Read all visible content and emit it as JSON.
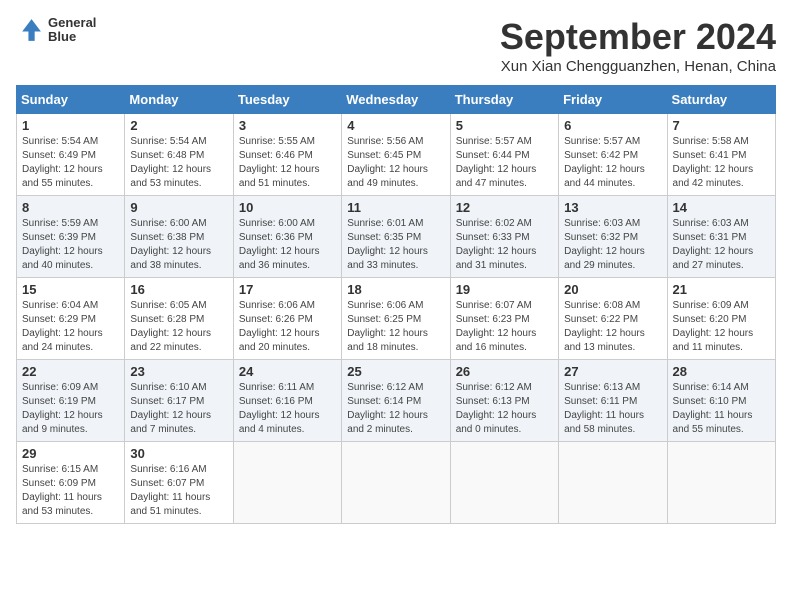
{
  "logo": {
    "line1": "General",
    "line2": "Blue"
  },
  "title": "September 2024",
  "location": "Xun Xian Chengguanzhen, Henan, China",
  "headers": [
    "Sunday",
    "Monday",
    "Tuesday",
    "Wednesday",
    "Thursday",
    "Friday",
    "Saturday"
  ],
  "weeks": [
    [
      {
        "day": "1",
        "sunrise": "5:54 AM",
        "sunset": "6:49 PM",
        "daylight": "12 hours and 55 minutes."
      },
      {
        "day": "2",
        "sunrise": "5:54 AM",
        "sunset": "6:48 PM",
        "daylight": "12 hours and 53 minutes."
      },
      {
        "day": "3",
        "sunrise": "5:55 AM",
        "sunset": "6:46 PM",
        "daylight": "12 hours and 51 minutes."
      },
      {
        "day": "4",
        "sunrise": "5:56 AM",
        "sunset": "6:45 PM",
        "daylight": "12 hours and 49 minutes."
      },
      {
        "day": "5",
        "sunrise": "5:57 AM",
        "sunset": "6:44 PM",
        "daylight": "12 hours and 47 minutes."
      },
      {
        "day": "6",
        "sunrise": "5:57 AM",
        "sunset": "6:42 PM",
        "daylight": "12 hours and 44 minutes."
      },
      {
        "day": "7",
        "sunrise": "5:58 AM",
        "sunset": "6:41 PM",
        "daylight": "12 hours and 42 minutes."
      }
    ],
    [
      {
        "day": "8",
        "sunrise": "5:59 AM",
        "sunset": "6:39 PM",
        "daylight": "12 hours and 40 minutes."
      },
      {
        "day": "9",
        "sunrise": "6:00 AM",
        "sunset": "6:38 PM",
        "daylight": "12 hours and 38 minutes."
      },
      {
        "day": "10",
        "sunrise": "6:00 AM",
        "sunset": "6:36 PM",
        "daylight": "12 hours and 36 minutes."
      },
      {
        "day": "11",
        "sunrise": "6:01 AM",
        "sunset": "6:35 PM",
        "daylight": "12 hours and 33 minutes."
      },
      {
        "day": "12",
        "sunrise": "6:02 AM",
        "sunset": "6:33 PM",
        "daylight": "12 hours and 31 minutes."
      },
      {
        "day": "13",
        "sunrise": "6:03 AM",
        "sunset": "6:32 PM",
        "daylight": "12 hours and 29 minutes."
      },
      {
        "day": "14",
        "sunrise": "6:03 AM",
        "sunset": "6:31 PM",
        "daylight": "12 hours and 27 minutes."
      }
    ],
    [
      {
        "day": "15",
        "sunrise": "6:04 AM",
        "sunset": "6:29 PM",
        "daylight": "12 hours and 24 minutes."
      },
      {
        "day": "16",
        "sunrise": "6:05 AM",
        "sunset": "6:28 PM",
        "daylight": "12 hours and 22 minutes."
      },
      {
        "day": "17",
        "sunrise": "6:06 AM",
        "sunset": "6:26 PM",
        "daylight": "12 hours and 20 minutes."
      },
      {
        "day": "18",
        "sunrise": "6:06 AM",
        "sunset": "6:25 PM",
        "daylight": "12 hours and 18 minutes."
      },
      {
        "day": "19",
        "sunrise": "6:07 AM",
        "sunset": "6:23 PM",
        "daylight": "12 hours and 16 minutes."
      },
      {
        "day": "20",
        "sunrise": "6:08 AM",
        "sunset": "6:22 PM",
        "daylight": "12 hours and 13 minutes."
      },
      {
        "day": "21",
        "sunrise": "6:09 AM",
        "sunset": "6:20 PM",
        "daylight": "12 hours and 11 minutes."
      }
    ],
    [
      {
        "day": "22",
        "sunrise": "6:09 AM",
        "sunset": "6:19 PM",
        "daylight": "12 hours and 9 minutes."
      },
      {
        "day": "23",
        "sunrise": "6:10 AM",
        "sunset": "6:17 PM",
        "daylight": "12 hours and 7 minutes."
      },
      {
        "day": "24",
        "sunrise": "6:11 AM",
        "sunset": "6:16 PM",
        "daylight": "12 hours and 4 minutes."
      },
      {
        "day": "25",
        "sunrise": "6:12 AM",
        "sunset": "6:14 PM",
        "daylight": "12 hours and 2 minutes."
      },
      {
        "day": "26",
        "sunrise": "6:12 AM",
        "sunset": "6:13 PM",
        "daylight": "12 hours and 0 minutes."
      },
      {
        "day": "27",
        "sunrise": "6:13 AM",
        "sunset": "6:11 PM",
        "daylight": "11 hours and 58 minutes."
      },
      {
        "day": "28",
        "sunrise": "6:14 AM",
        "sunset": "6:10 PM",
        "daylight": "11 hours and 55 minutes."
      }
    ],
    [
      {
        "day": "29",
        "sunrise": "6:15 AM",
        "sunset": "6:09 PM",
        "daylight": "11 hours and 53 minutes."
      },
      {
        "day": "30",
        "sunrise": "6:16 AM",
        "sunset": "6:07 PM",
        "daylight": "11 hours and 51 minutes."
      },
      null,
      null,
      null,
      null,
      null
    ]
  ]
}
